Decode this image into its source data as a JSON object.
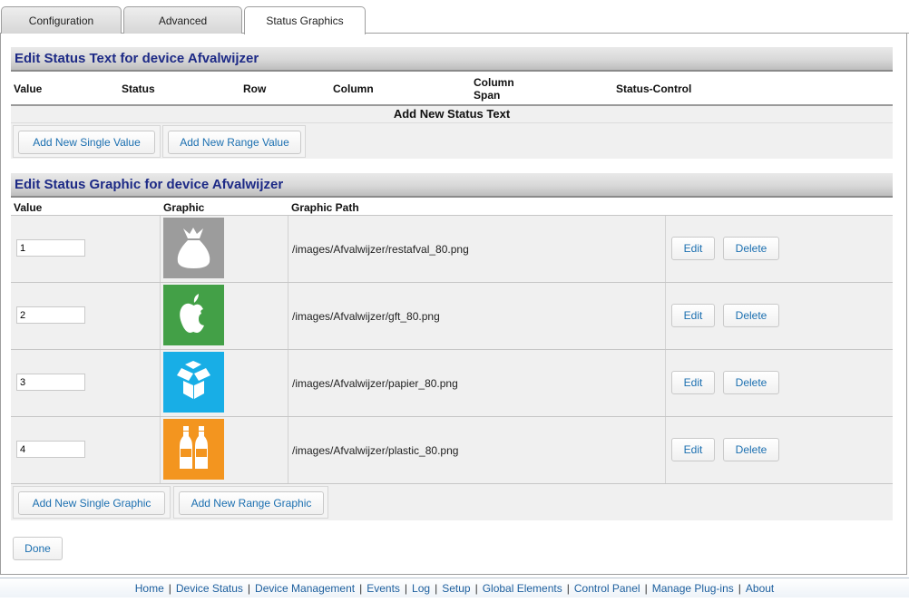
{
  "tabs": [
    {
      "label": "Configuration"
    },
    {
      "label": "Advanced"
    },
    {
      "label": "Status Graphics",
      "active": true
    }
  ],
  "status_text": {
    "title": "Edit Status Text for device Afvalwijzer",
    "columns": [
      "Value",
      "Status",
      "Row",
      "Column",
      "Column Span",
      "Status-Control"
    ],
    "add_label": "Add New Status Text",
    "buttons": {
      "single": "Add New Single Value",
      "range": "Add New Range Value"
    }
  },
  "status_graphic": {
    "title": "Edit Status Graphic for device Afvalwijzer",
    "columns": [
      "Value",
      "Graphic",
      "Graphic Path"
    ],
    "rows": [
      {
        "value": "1",
        "path": "/images/Afvalwijzer/restafval_80.png",
        "icon": "trash-bag-icon",
        "color": "#9c9c9c"
      },
      {
        "value": "2",
        "path": "/images/Afvalwijzer/gft_80.png",
        "icon": "apple-icon",
        "color": "#43a047"
      },
      {
        "value": "3",
        "path": "/images/Afvalwijzer/papier_80.png",
        "icon": "open-box-icon",
        "color": "#18aee6"
      },
      {
        "value": "4",
        "path": "/images/Afvalwijzer/plastic_80.png",
        "icon": "bottles-icon",
        "color": "#f3951f"
      }
    ],
    "edit_label": "Edit",
    "delete_label": "Delete",
    "buttons": {
      "single": "Add New Single Graphic",
      "range": "Add New Range Graphic"
    }
  },
  "done_label": "Done",
  "footer_links": [
    "Home",
    "Device Status",
    "Device Management",
    "Events",
    "Log",
    "Setup",
    "Global Elements",
    "Control Panel",
    "Manage Plug-ins",
    "About"
  ]
}
